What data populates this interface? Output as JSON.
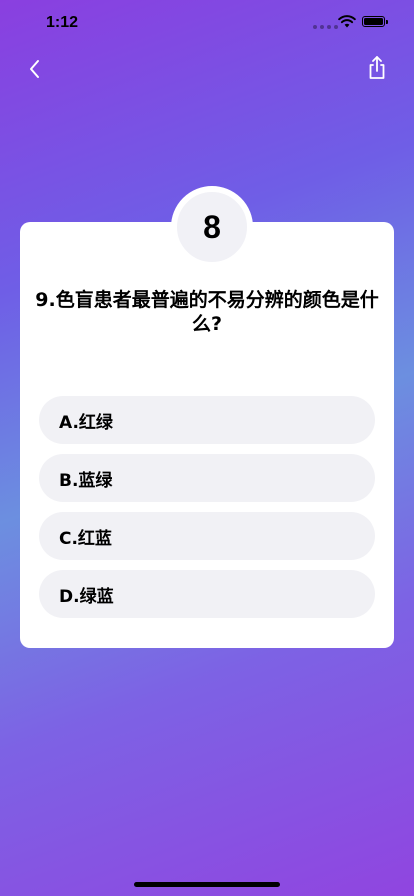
{
  "status_bar": {
    "time": "1:12"
  },
  "icons": {
    "back": "chevron-left-icon",
    "share": "share-icon"
  },
  "quiz": {
    "badge_number": "8",
    "question": "9.色盲患者最普遍的不易分辨的颜色是什么?",
    "options": [
      {
        "label": "A.红绿"
      },
      {
        "label": "B.蓝绿"
      },
      {
        "label": "C.红蓝"
      },
      {
        "label": "D.绿蓝"
      }
    ]
  },
  "colors": {
    "background_top": "#8a3fe0",
    "background_mid": "#6c8fe0",
    "card": "#ffffff",
    "option_bg": "#f1f1f5"
  }
}
